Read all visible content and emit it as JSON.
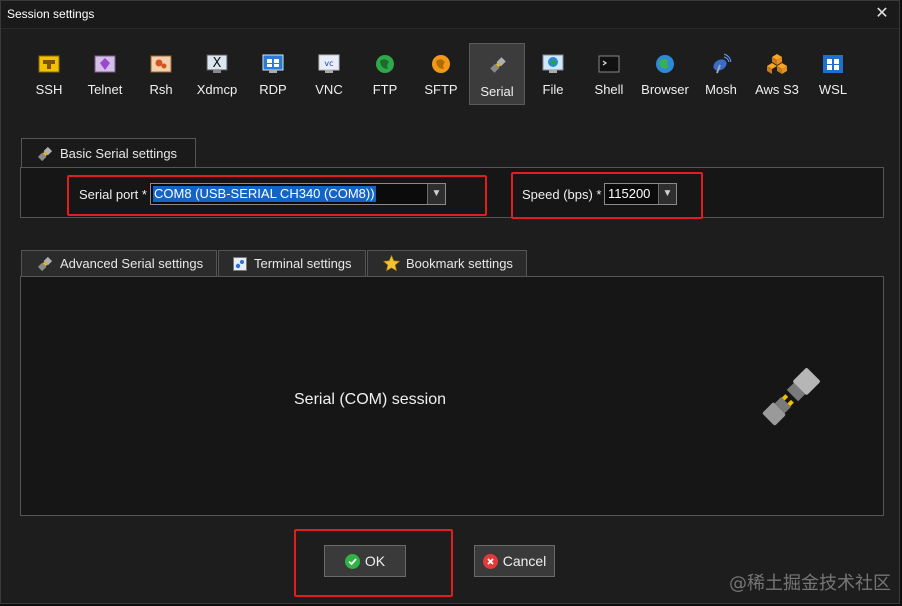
{
  "window": {
    "title": "Session settings"
  },
  "protocols": [
    {
      "label": "SSH",
      "icon": "ssh-key-icon"
    },
    {
      "label": "Telnet",
      "icon": "telnet-icon"
    },
    {
      "label": "Rsh",
      "icon": "rsh-icon"
    },
    {
      "label": "Xdmcp",
      "icon": "xdmcp-icon"
    },
    {
      "label": "RDP",
      "icon": "rdp-icon"
    },
    {
      "label": "VNC",
      "icon": "vnc-icon"
    },
    {
      "label": "FTP",
      "icon": "ftp-icon"
    },
    {
      "label": "SFTP",
      "icon": "sftp-icon"
    },
    {
      "label": "Serial",
      "icon": "serial-plug-icon",
      "selected": true
    },
    {
      "label": "File",
      "icon": "file-icon"
    },
    {
      "label": "Shell",
      "icon": "shell-icon"
    },
    {
      "label": "Browser",
      "icon": "browser-globe-icon"
    },
    {
      "label": "Mosh",
      "icon": "mosh-antenna-icon"
    },
    {
      "label": "Aws S3",
      "icon": "aws-s3-icon"
    },
    {
      "label": "WSL",
      "icon": "wsl-icon"
    }
  ],
  "basic": {
    "tab_label": "Basic Serial settings",
    "serial_port_label": "Serial port *",
    "serial_port_value": "COM8  (USB-SERIAL CH340 (COM8))",
    "speed_label": "Speed (bps) *",
    "speed_value": "115200"
  },
  "tabs": [
    {
      "label": "Advanced Serial settings",
      "icon": "plug-icon"
    },
    {
      "label": "Terminal settings",
      "icon": "terminal-settings-icon"
    },
    {
      "label": "Bookmark settings",
      "icon": "star-icon"
    }
  ],
  "session_text": "Serial (COM) session",
  "buttons": {
    "ok": "OK",
    "cancel": "Cancel"
  },
  "watermark": "@稀土掘金技术社区",
  "colors": {
    "highlight": "#e11d1d",
    "selection": "#1464c8",
    "ok_green": "#2fb344",
    "cancel_red": "#e23a3a"
  }
}
